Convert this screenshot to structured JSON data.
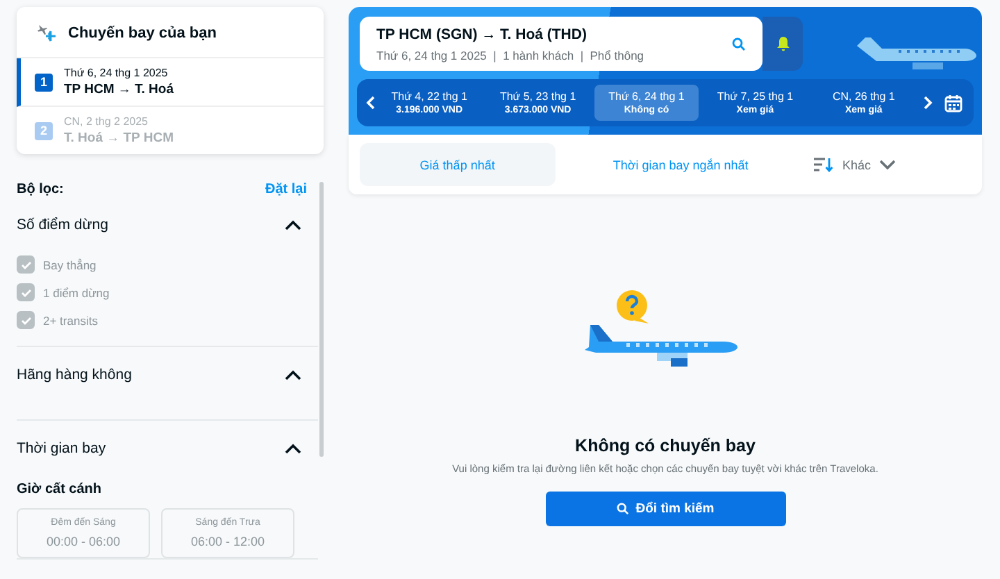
{
  "trip_card": {
    "title": "Chuyến bay của bạn",
    "legs": [
      {
        "number": "1",
        "date": "Thứ 6, 24 thg 1 2025",
        "route": "TP HCM → T. Hoá",
        "selected": true,
        "disabled": false
      },
      {
        "number": "2",
        "date": "CN, 2 thg 2 2025",
        "route": "T. Hoá → TP HCM",
        "selected": false,
        "disabled": true
      }
    ]
  },
  "filters": {
    "title": "Bộ lọc:",
    "reset": "Đặt lại",
    "sections": [
      {
        "kind": "checklist",
        "title": "Số điểm dừng",
        "expanded": true,
        "options": [
          {
            "label": "Bay thẳng",
            "checked": true,
            "disabled": true
          },
          {
            "label": "1 điểm dừng",
            "checked": true,
            "disabled": true
          },
          {
            "label": "2+ transits",
            "checked": true,
            "disabled": true
          }
        ]
      },
      {
        "kind": "plain",
        "title": "Hãng hàng không",
        "expanded": true
      },
      {
        "kind": "times",
        "title": "Thời gian bay",
        "expanded": true,
        "subtitle": "Giờ cất cánh",
        "slots": [
          {
            "label": "Đêm đến Sáng",
            "time": "00:00 - 06:00",
            "disabled": true
          },
          {
            "label": "Sáng đến Trưa",
            "time": "06:00 - 12:00",
            "disabled": true
          }
        ]
      }
    ]
  },
  "search": {
    "route": "TP HCM (SGN) → T. Hoá (THD)",
    "details": "Thứ 6, 24 thg 1 2025  |  1 hành khách  |  Phổ thông"
  },
  "dates": [
    {
      "day": "Thứ 4, 22 thg 1",
      "price": "3.196.000 VND",
      "selected": false
    },
    {
      "day": "Thứ 5, 23 thg 1",
      "price": "3.673.000 VND",
      "selected": false
    },
    {
      "day": "Thứ 6, 24 thg 1",
      "price": "Không có",
      "selected": true
    },
    {
      "day": "Thứ 7, 25 thg 1",
      "price": "Xem giá",
      "selected": false
    },
    {
      "day": "CN, 26 thg 1",
      "price": "Xem giá",
      "selected": false
    }
  ],
  "sort_tabs": [
    {
      "label": "Giá thấp nhất",
      "selected": true
    },
    {
      "label": "Thời gian bay ngắn nhất",
      "selected": false
    }
  ],
  "more_sort": "Khác",
  "empty": {
    "title": "Không có chuyến bay",
    "message": "Vui lòng kiểm tra lại đường liên kết hoặc chọn các chuyến bay tuyệt vời khác trên Traveloka.",
    "button": "Đổi tìm kiếm"
  }
}
